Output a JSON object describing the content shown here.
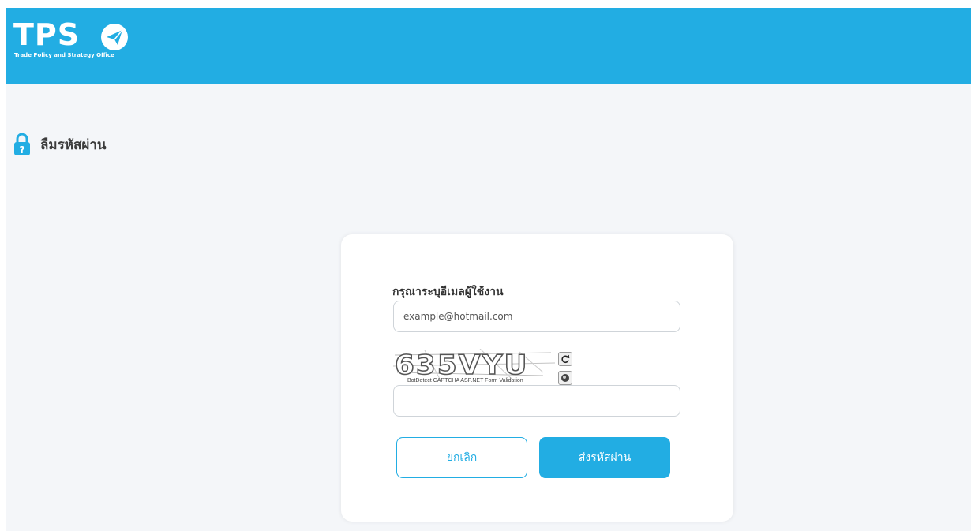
{
  "header": {
    "logo_text": "TPS",
    "logo_subtitle": "Trade Policy and Strategy Office"
  },
  "page": {
    "title": "ลืมรหัสผ่าน"
  },
  "form": {
    "email_label": "กรุณาระบุอีเมลผู้ใช้งาน",
    "email_placeholder": "example@hotmail.com",
    "captcha_code": "635VYU",
    "captcha_caption": "BotDetect CAPTCHA ASP.NET Form Validation",
    "captcha_value": "",
    "cancel_label": "ยกเลิก",
    "submit_label": "ส่งรหัสผ่าน"
  },
  "icons": {
    "lock": "lock-question-icon",
    "reload": "reload-icon",
    "sound": "speaker-icon",
    "logo_mark": "paper-plane-icon"
  },
  "colors": {
    "brand": "#22ade3",
    "page_bg": "#f4f6f9",
    "card_bg": "#ffffff",
    "title_text": "#3b3b3b"
  }
}
